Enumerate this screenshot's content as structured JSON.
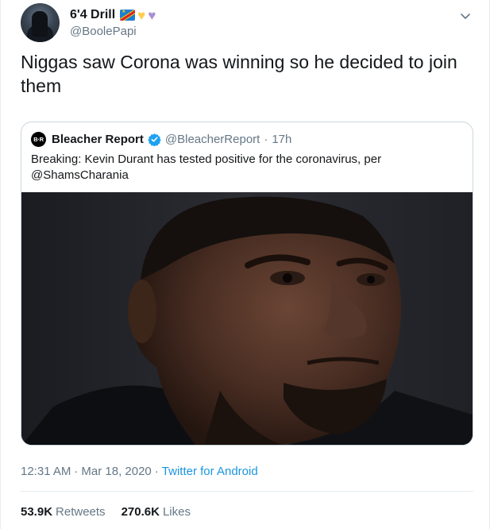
{
  "author": {
    "display_name": "6'4 Drill",
    "handle": "@BoolePapi",
    "emoji": [
      "flag-dr-congo",
      "yellow-heart",
      "purple-heart"
    ]
  },
  "tweet": {
    "text": "Niggas saw Corona was winning so he decided to join them"
  },
  "quoted_tweet": {
    "logo_text": "B·R",
    "name": "Bleacher Report",
    "handle": "@BleacherReport",
    "dot": "·",
    "time": "17h",
    "text": "Breaking: Kevin Durant has tested positive for the coronavirus, per @ShamsCharania"
  },
  "meta": {
    "time": "12:31 AM",
    "separator1": "·",
    "date": "Mar 18, 2020",
    "separator2": "·",
    "source": "Twitter for Android"
  },
  "stats": {
    "retweets_count": "53.9K",
    "retweets_label": "Retweets",
    "likes_count": "270.6K",
    "likes_label": "Likes"
  },
  "colors": {
    "link": "#1b95e0",
    "secondary_text": "#657786",
    "border": "#ccd6dd",
    "verified": "#1da1f2"
  },
  "icons": [
    "chevron-down-icon",
    "verified-badge-icon"
  ]
}
